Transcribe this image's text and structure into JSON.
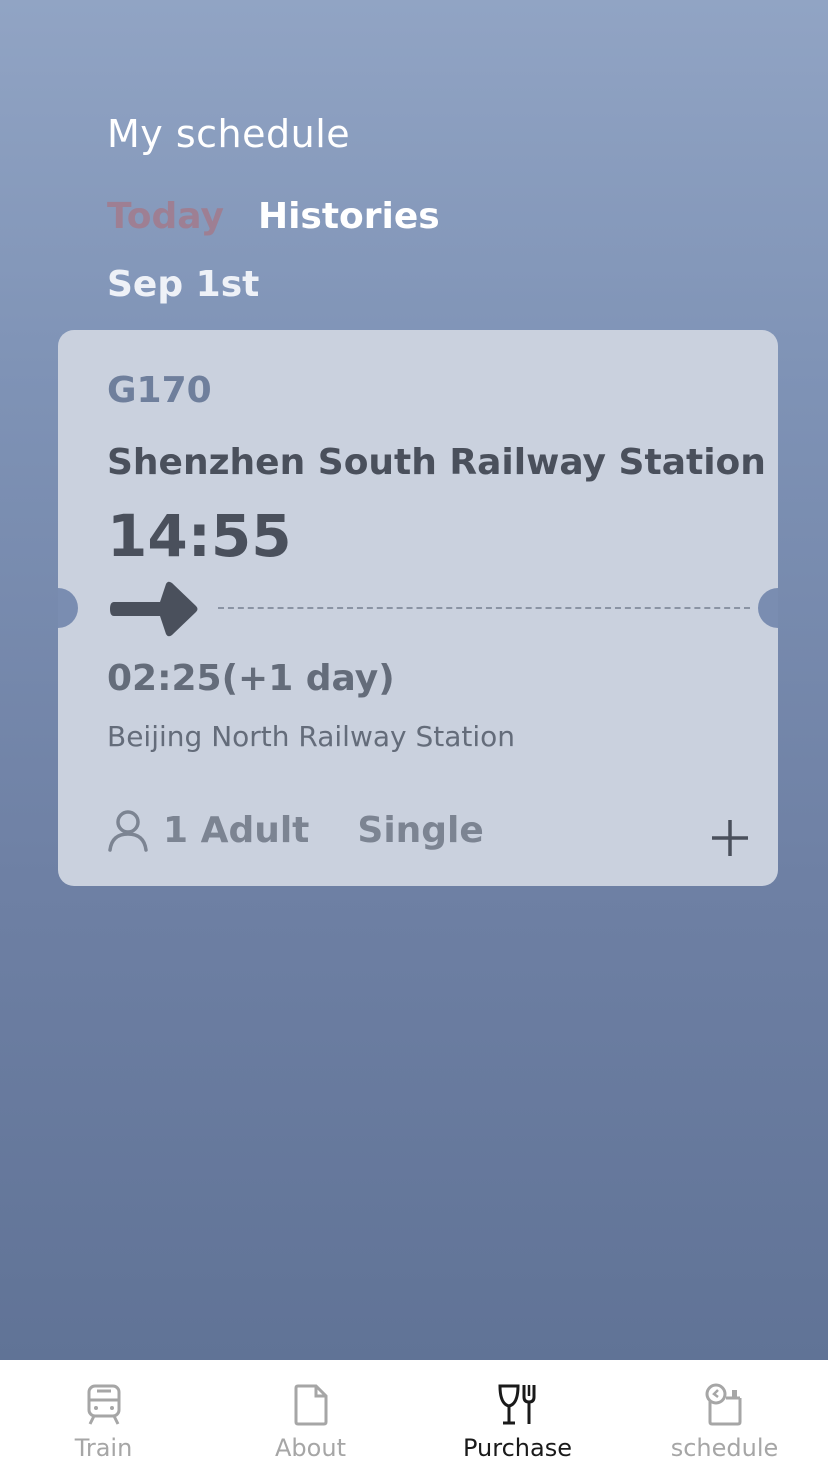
{
  "header": {
    "title": "My schedule",
    "tabs": [
      {
        "label": "Today",
        "active": true
      },
      {
        "label": "Histories",
        "active": false
      }
    ],
    "date": "Sep 1st"
  },
  "ticket": {
    "train_number": "G170",
    "from_station": "Shenzhen South Railway Station",
    "depart_time": "14:55",
    "arrive_time": "02:25(+1 day)",
    "to_station": "Beijing North Railway Station",
    "passengers": "1 Adult",
    "ticket_type": "Single",
    "icons": {
      "direction": "arrow-right-icon",
      "passenger": "person-icon",
      "add": "plus-icon"
    }
  },
  "tab_bar": {
    "items": [
      {
        "label": "Train",
        "icon": "train-icon",
        "active": false
      },
      {
        "label": "About",
        "icon": "document-icon",
        "active": false
      },
      {
        "label": "Purchase",
        "icon": "dining-icon",
        "active": true
      },
      {
        "label": "schedule",
        "icon": "schedule-icon",
        "active": false
      }
    ]
  },
  "colors": {
    "background_top": "#91a4c4",
    "background_bottom": "#5d7093",
    "ticket_bg": "#cad1de",
    "today_tab": "#9e7f93",
    "active_tab_text": "#1a1a1a",
    "inactive_tab_text": "#a6a6a6"
  }
}
